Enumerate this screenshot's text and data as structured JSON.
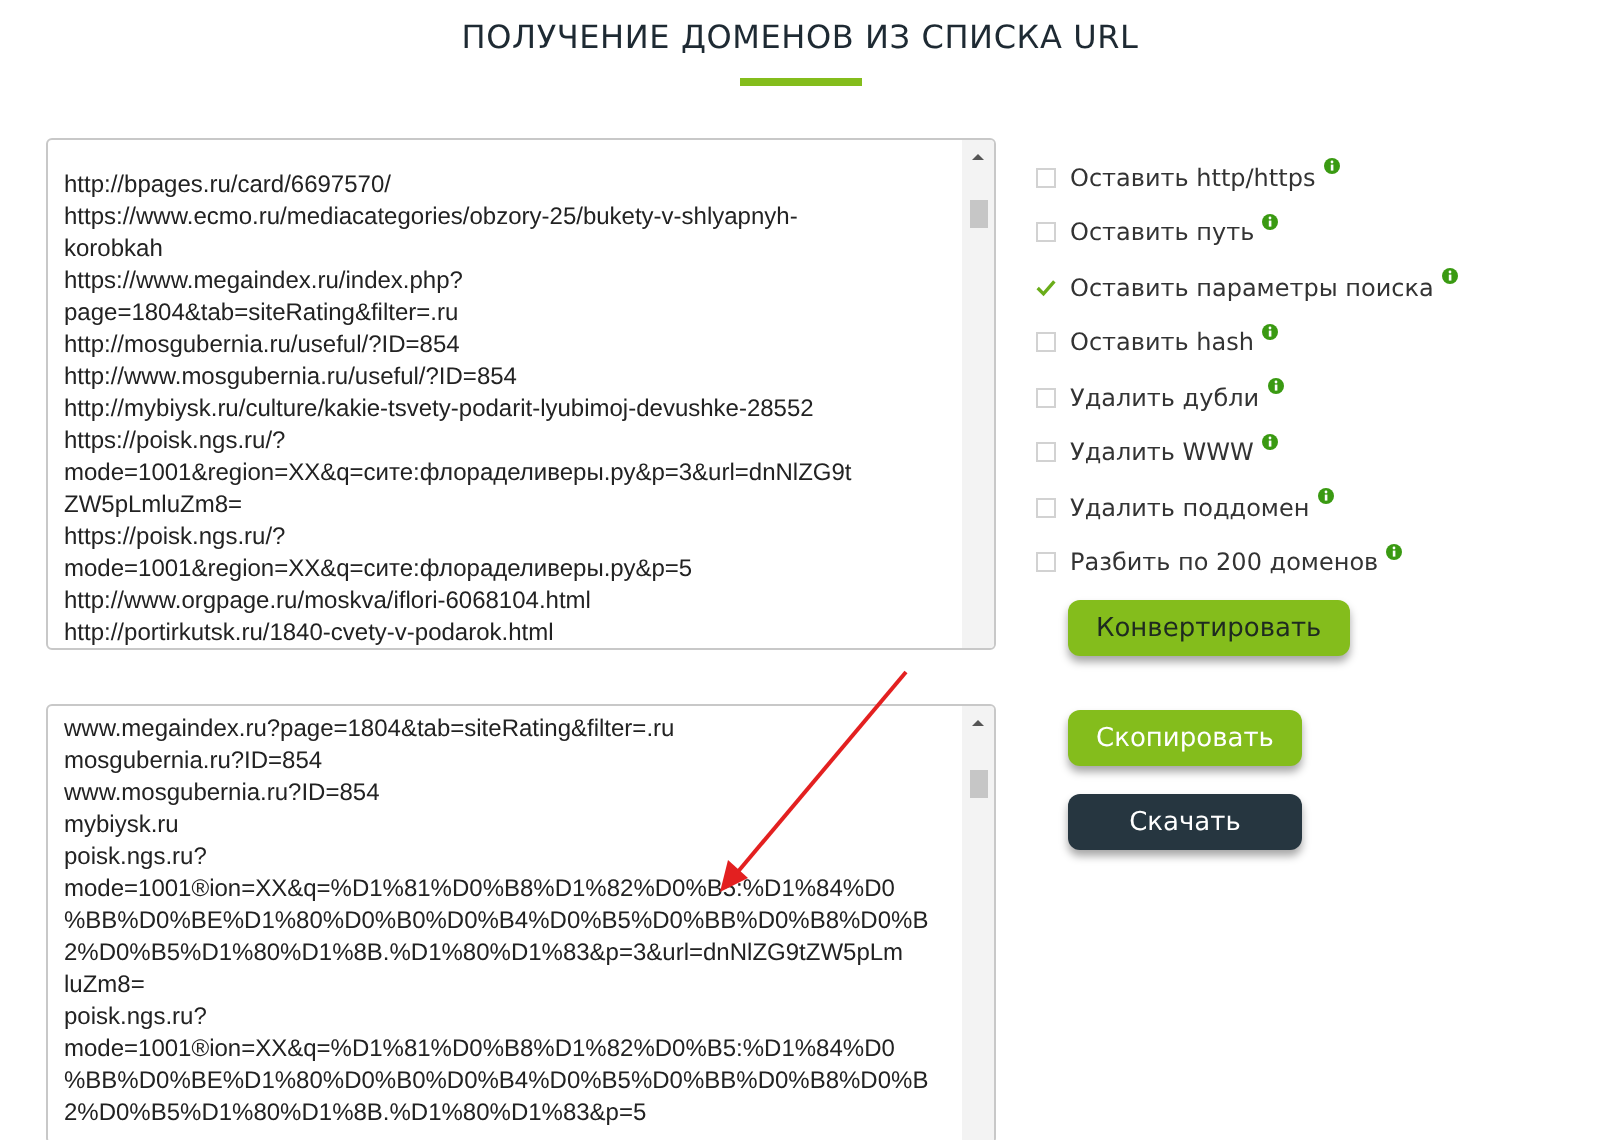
{
  "title": "ПОЛУЧЕНИЕ ДОМЕНОВ ИЗ СПИСКА URL",
  "input_lines": [
    "http://bpages.ru/card/6697570/",
    "https://www.ecmo.ru/mediacategories/obzory-25/bukety-v-shlyapnyh-",
    "korobkah",
    "https://www.megaindex.ru/index.php?",
    "page=1804&tab=siteRating&filter=.ru",
    "http://mosgubernia.ru/useful/?ID=854",
    "http://www.mosgubernia.ru/useful/?ID=854",
    "http://mybiysk.ru/culture/kakie-tsvety-podarit-lyubimoj-devushke-28552",
    "https://poisk.ngs.ru/?",
    "mode=1001&region=XX&q=сите:флораделиверы.ру&p=3&url=dnNlZG9t",
    "ZW5pLmluZm8=",
    "https://poisk.ngs.ru/?",
    "mode=1001&region=XX&q=сите:флораделиверы.ру&p=5",
    "http://www.orgpage.ru/moskva/iflori-6068104.html",
    "http://portirkutsk.ru/1840-cvety-v-podarok.html"
  ],
  "options": [
    {
      "label": "Оставить http/https",
      "checked": false
    },
    {
      "label": "Оставить путь",
      "checked": false
    },
    {
      "label": "Оставить параметры поиска",
      "checked": true
    },
    {
      "label": "Оставить hash",
      "checked": false
    },
    {
      "label": "Удалить дубли",
      "checked": false
    },
    {
      "label": "Удалить WWW",
      "checked": false
    },
    {
      "label": "Удалить поддомен",
      "checked": false
    },
    {
      "label": "Разбить по 200 доменов",
      "checked": false
    }
  ],
  "convert_button": "Конвертировать",
  "output_lines": [
    "www.megaindex.ru?page=1804&tab=siteRating&filter=.ru",
    "mosgubernia.ru?ID=854",
    "www.mosgubernia.ru?ID=854",
    "mybiysk.ru",
    "poisk.ngs.ru?",
    "mode=1001®ion=XX&q=%D1%81%D0%B8%D1%82%D0%B5:%D1%84%D0",
    "%BB%D0%BE%D1%80%D0%B0%D0%B4%D0%B5%D0%BB%D0%B8%D0%B",
    "2%D0%B5%D1%80%D1%8B.%D1%80%D1%83&p=3&url=dnNlZG9tZW5pLm",
    "luZm8=",
    "poisk.ngs.ru?",
    "mode=1001®ion=XX&q=%D1%81%D0%B8%D1%82%D0%B5:%D1%84%D0",
    "%BB%D0%BE%D1%80%D0%B0%D0%B4%D0%B5%D0%BB%D0%B8%D0%B",
    "2%D0%B5%D1%80%D1%8B.%D1%80%D1%83&p=5"
  ],
  "buttons": [
    {
      "label": "Скопировать",
      "kind": "copy"
    },
    {
      "label": "Скачать",
      "kind": "download"
    }
  ]
}
